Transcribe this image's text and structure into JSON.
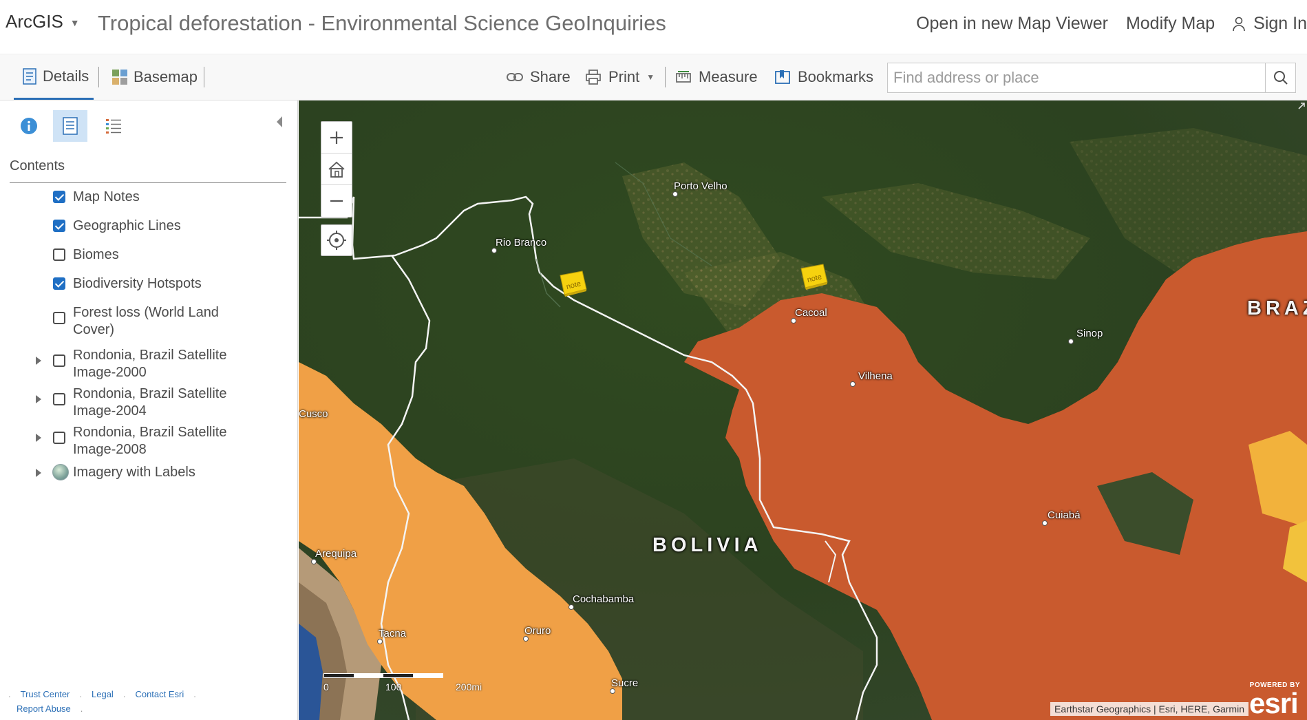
{
  "header": {
    "brand": "ArcGIS",
    "title": "Tropical deforestation - Environmental Science GeoInquiries",
    "links": {
      "open_viewer": "Open in new Map Viewer",
      "modify_map": "Modify Map",
      "sign_in": "Sign In"
    }
  },
  "toolbar": {
    "details": "Details",
    "basemap": "Basemap",
    "share": "Share",
    "print": "Print",
    "measure": "Measure",
    "bookmarks": "Bookmarks",
    "search_placeholder": "Find address or place"
  },
  "panel": {
    "heading": "Contents",
    "layers": [
      {
        "label": "Map Notes",
        "checked": true,
        "expandable": false,
        "kind": "checkbox"
      },
      {
        "label": "Geographic Lines",
        "checked": true,
        "expandable": false,
        "kind": "checkbox"
      },
      {
        "label": "Biomes",
        "checked": false,
        "expandable": false,
        "kind": "checkbox"
      },
      {
        "label": "Biodiversity Hotspots",
        "checked": true,
        "expandable": false,
        "kind": "checkbox"
      },
      {
        "label": "Forest loss (World Land Cover)",
        "checked": false,
        "expandable": false,
        "kind": "checkbox"
      },
      {
        "label": "Rondonia, Brazil Satellite Image-2000",
        "checked": false,
        "expandable": true,
        "kind": "checkbox"
      },
      {
        "label": "Rondonia, Brazil Satellite Image-2004",
        "checked": false,
        "expandable": true,
        "kind": "checkbox"
      },
      {
        "label": "Rondonia, Brazil Satellite Image-2008",
        "checked": false,
        "expandable": true,
        "kind": "checkbox"
      },
      {
        "label": "Imagery with Labels",
        "checked": false,
        "expandable": true,
        "kind": "basemap"
      }
    ],
    "footer": {
      "trust": "Trust Center",
      "legal": "Legal",
      "contact": "Contact Esri",
      "abuse": "Report Abuse"
    }
  },
  "map": {
    "places": [
      {
        "name": "Porto Velho"
      },
      {
        "name": "Rio Branco"
      },
      {
        "name": "Cacoal"
      },
      {
        "name": "Sinop"
      },
      {
        "name": "Vilhena"
      },
      {
        "name": "Cusco"
      },
      {
        "name": "Cuiabá"
      },
      {
        "name": "Arequipa"
      },
      {
        "name": "Cochabamba"
      },
      {
        "name": "Oruro"
      },
      {
        "name": "Tacna"
      },
      {
        "name": "Sucre"
      }
    ],
    "countries": {
      "bolivia": "BOLIVIA",
      "brazil": "BRAZ"
    },
    "note_text": "note",
    "scale": {
      "zero": "0",
      "mid": "100",
      "end": "200mi"
    },
    "attribution": "Earthstar Geographics | Esri, HERE, Garmin",
    "logo_powered": "POWERED BY",
    "logo_name": "esri",
    "colors": {
      "hotspot_dark": "#c95a2e",
      "hotspot_light": "#f0a046",
      "forest": "#2f4a22",
      "accent": "#2b6fb6"
    }
  }
}
